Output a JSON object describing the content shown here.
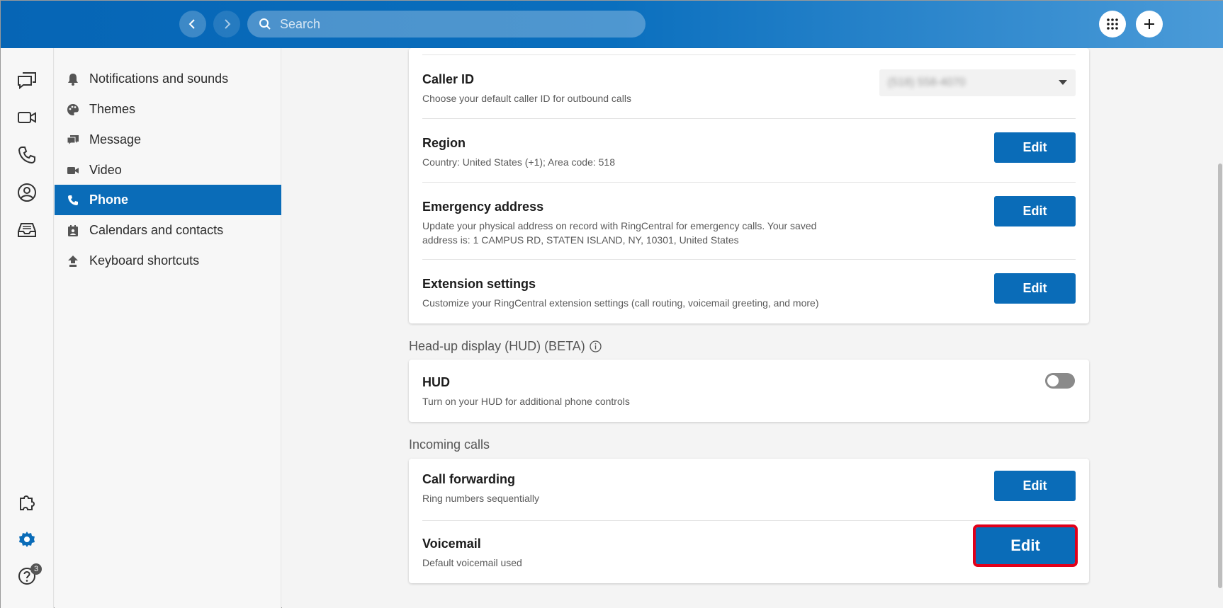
{
  "search": {
    "placeholder": "Search"
  },
  "sidebar": {
    "items": [
      {
        "label": "Notifications and sounds",
        "icon": "bell-icon"
      },
      {
        "label": "Themes",
        "icon": "palette-icon"
      },
      {
        "label": "Message",
        "icon": "chat-icon"
      },
      {
        "label": "Video",
        "icon": "video-icon"
      },
      {
        "label": "Phone",
        "icon": "phone-icon",
        "active": true
      },
      {
        "label": "Calendars and contacts",
        "icon": "contacts-icon"
      },
      {
        "label": "Keyboard shortcuts",
        "icon": "shortcut-icon"
      }
    ]
  },
  "rail": {
    "help_badge": "3"
  },
  "phone": {
    "caller_id": {
      "title": "Caller ID",
      "desc": "Choose your default caller ID for outbound calls",
      "value": "(518) 558-4070"
    },
    "region": {
      "title": "Region",
      "desc": "Country: United States (+1); Area code: 518",
      "button": "Edit"
    },
    "emergency": {
      "title": "Emergency address",
      "desc_line1": "Update your physical address on record with RingCentral for emergency calls. Your saved",
      "desc_line2": "address is: 1 CAMPUS RD, STATEN ISLAND, NY, 10301, United States",
      "button": "Edit"
    },
    "extension": {
      "title": "Extension settings",
      "desc": "Customize your RingCentral extension settings (call routing, voicemail greeting, and more)",
      "button": "Edit"
    }
  },
  "hud": {
    "section": "Head-up display (HUD) (BETA)",
    "title": "HUD",
    "desc": "Turn on your HUD for additional phone controls",
    "enabled": false
  },
  "incoming": {
    "section": "Incoming calls",
    "forwarding": {
      "title": "Call forwarding",
      "desc": "Ring numbers sequentially",
      "button": "Edit"
    },
    "voicemail": {
      "title": "Voicemail",
      "desc": "Default voicemail used",
      "button": "Edit"
    }
  },
  "colors": {
    "brand": "#0a6cb8",
    "highlight": "#e1001a"
  }
}
